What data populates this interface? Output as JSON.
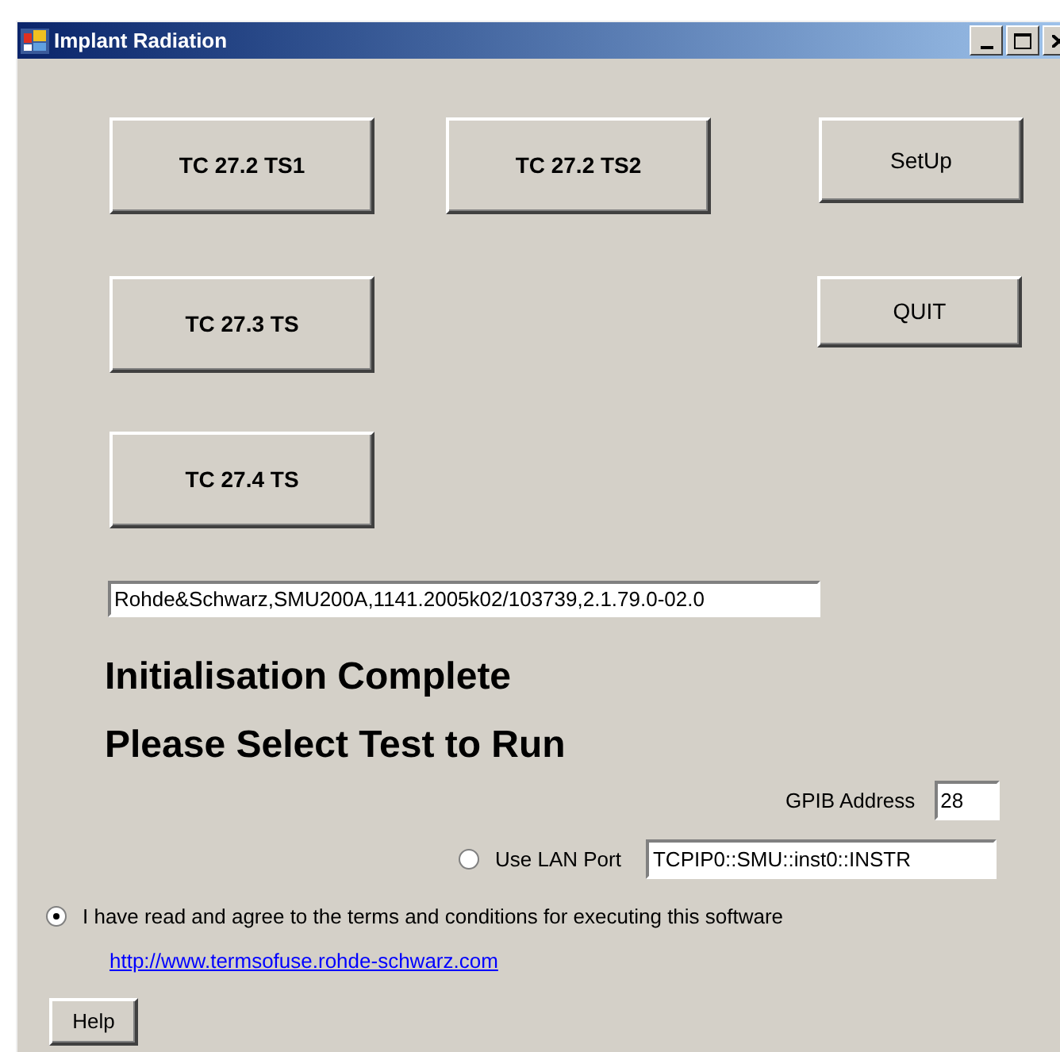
{
  "window": {
    "title": "Implant Radiation"
  },
  "test_buttons": [
    "TC 27.2 TS1",
    "TC 27.2 TS2",
    "TC 27.3 TS",
    "TC 27.4 TS"
  ],
  "setup_button": "SetUp",
  "quit_button": "QUIT",
  "instrument_id": {
    "value": "Rohde&Schwarz,SMU200A,1141.2005k02/103739,2.1.79.0-02.0"
  },
  "status_lines": [
    "Initialisation Complete",
    "Please Select Test to Run"
  ],
  "gpib": {
    "label": "GPIB Address",
    "value": "28"
  },
  "lan": {
    "label": "Use LAN Port",
    "selected": false,
    "value": "TCPIP0::SMU::inst0::INSTR"
  },
  "agree": {
    "label": "I have read and agree to the terms and conditions for executing this software",
    "selected": true
  },
  "link": "http://www.termsofuse.rohde-schwarz.com",
  "help_button": "Help"
}
